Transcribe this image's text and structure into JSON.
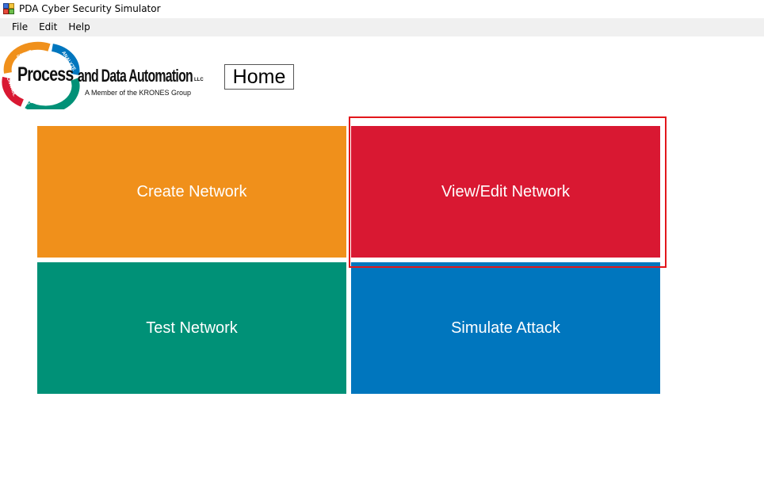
{
  "window": {
    "title": "PDA Cyber Security Simulator",
    "icon": "app-icon"
  },
  "menu": {
    "items": [
      {
        "label": "File"
      },
      {
        "label": "Edit"
      },
      {
        "label": "Help"
      }
    ]
  },
  "logo": {
    "main_big": "Process",
    "main_rest": "and Data Automation",
    "llc": "LLC",
    "subtitle": "A Member of the KRONES Group",
    "ring_words": [
      "SETUP",
      "ANALYZE",
      "COLLECT",
      "CONTROL"
    ]
  },
  "page": {
    "title": "Home"
  },
  "tiles": {
    "create": {
      "label": "Create Network",
      "color": "#f0901b"
    },
    "view_edit": {
      "label": "View/Edit Network",
      "color": "#d91832"
    },
    "test": {
      "label": "Test Network",
      "color": "#009177"
    },
    "attack": {
      "label": "Simulate Attack",
      "color": "#0076be"
    }
  },
  "highlight": {
    "color": "#e3161b",
    "target": "view_edit"
  }
}
